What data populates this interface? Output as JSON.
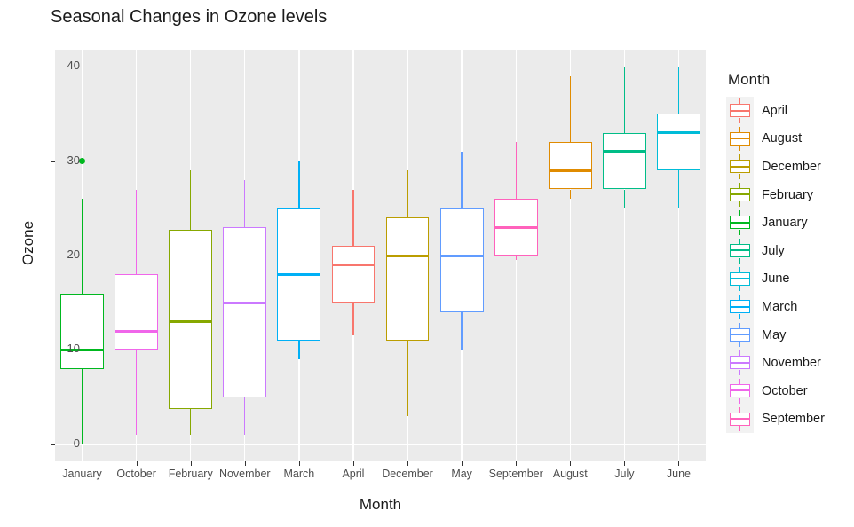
{
  "chart_data": {
    "type": "boxplot",
    "title": "Seasonal Changes in Ozone levels",
    "xlabel": "Month",
    "ylabel": "Ozone",
    "ylim": [
      0,
      40
    ],
    "y_ticks": [
      0,
      10,
      20,
      30,
      40
    ],
    "y_minor_ticks": [
      5,
      15,
      25,
      35
    ],
    "grid": true,
    "legend_title": "Month",
    "legend_position": "right",
    "categories": [
      "January",
      "October",
      "February",
      "November",
      "March",
      "April",
      "December",
      "May",
      "September",
      "August",
      "July",
      "June"
    ],
    "boxes": [
      {
        "name": "January",
        "color": "#00B81F",
        "min": 0,
        "q1": 8,
        "median": 10,
        "q3": 16,
        "max": 26,
        "outliers": [
          30
        ]
      },
      {
        "name": "October",
        "color": "#F066EA",
        "min": 1,
        "q1": 10,
        "median": 12,
        "q3": 18,
        "max": 27,
        "outliers": []
      },
      {
        "name": "February",
        "color": "#87A800",
        "min": 1,
        "q1": 3.75,
        "median": 13,
        "q3": 22.75,
        "max": 29,
        "outliers": []
      },
      {
        "name": "November",
        "color": "#CB79FF",
        "min": 1,
        "q1": 5,
        "median": 15,
        "q3": 23,
        "max": 28,
        "outliers": []
      },
      {
        "name": "March",
        "color": "#00B0F6",
        "min": 9,
        "q1": 11,
        "median": 18,
        "q3": 25,
        "max": 30,
        "outliers": []
      },
      {
        "name": "April",
        "color": "#F8766D",
        "min": 11.5,
        "q1": 15,
        "median": 19,
        "q3": 21,
        "max": 27,
        "outliers": []
      },
      {
        "name": "December",
        "color": "#BB9D00",
        "min": 3,
        "q1": 11,
        "median": 20,
        "q3": 24,
        "max": 29,
        "outliers": []
      },
      {
        "name": "May",
        "color": "#619CFF",
        "min": 10,
        "q1": 14,
        "median": 20,
        "q3": 25,
        "max": 31,
        "outliers": []
      },
      {
        "name": "September",
        "color": "#FF62BC",
        "min": 19.5,
        "q1": 20,
        "median": 23,
        "q3": 26,
        "max": 32,
        "outliers": []
      },
      {
        "name": "August",
        "color": "#E08B00",
        "min": 26,
        "q1": 27,
        "median": 29,
        "q3": 32,
        "max": 39,
        "outliers": []
      },
      {
        "name": "July",
        "color": "#00BD87",
        "min": 25,
        "q1": 27,
        "median": 31,
        "q3": 33,
        "max": 40,
        "outliers": []
      },
      {
        "name": "June",
        "color": "#00BCD8",
        "min": 25,
        "q1": 29,
        "median": 33,
        "q3": 35,
        "max": 40,
        "outliers": []
      }
    ],
    "legend_entries": [
      {
        "label": "April",
        "color": "#F8766D"
      },
      {
        "label": "August",
        "color": "#E08B00"
      },
      {
        "label": "December",
        "color": "#BB9D00"
      },
      {
        "label": "February",
        "color": "#87A800"
      },
      {
        "label": "January",
        "color": "#00B81F"
      },
      {
        "label": "July",
        "color": "#00BD87"
      },
      {
        "label": "June",
        "color": "#00BCD8"
      },
      {
        "label": "March",
        "color": "#00B0F6"
      },
      {
        "label": "May",
        "color": "#619CFF"
      },
      {
        "label": "November",
        "color": "#CB79FF"
      },
      {
        "label": "October",
        "color": "#F066EA"
      },
      {
        "label": "September",
        "color": "#FF62BC"
      }
    ],
    "panel_background": "#EBEBEB",
    "grid_color": "#FFFFFF"
  }
}
